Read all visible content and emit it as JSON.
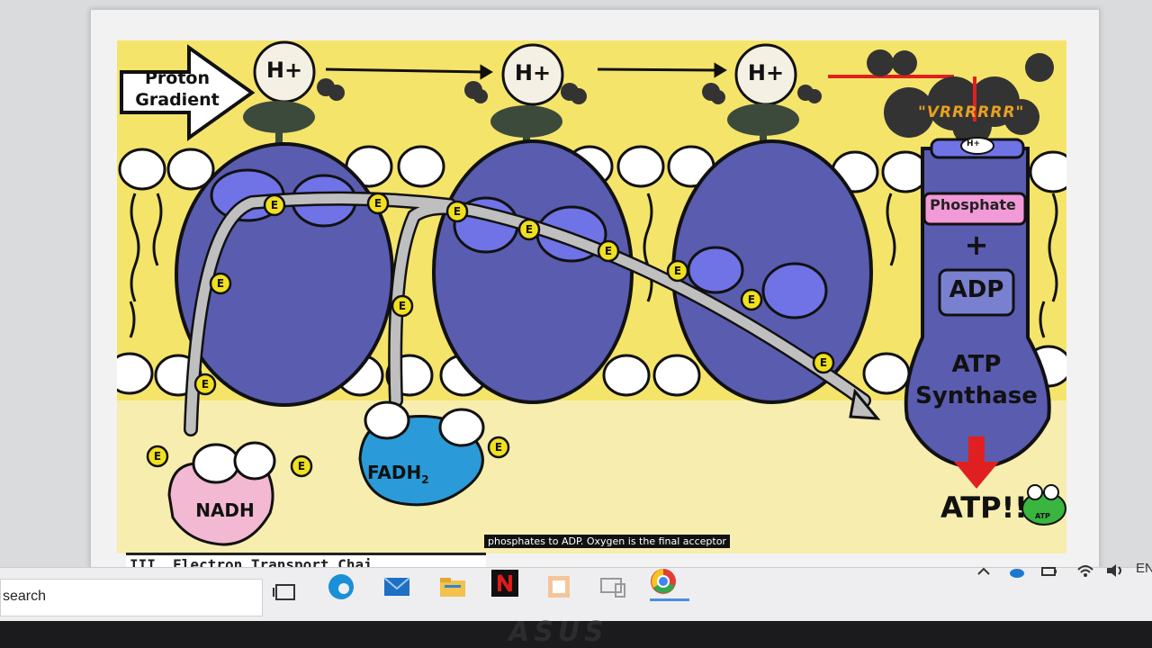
{
  "slide": {
    "proton_gradient_line1": "Proton",
    "proton_gradient_line2": "Gradient",
    "hplus_1": "H+",
    "hplus_2": "H+",
    "hplus_3": "H+",
    "hplus_small": "H+",
    "vrrr": "\"VRRRRRR\"",
    "phosphate": "Phosphate",
    "plus": "+",
    "adp": "ADP",
    "atp_synthase_line1": "ATP",
    "atp_synthase_line2": "Synthase",
    "atp_final": "ATP!!",
    "atp_frog": "ATP",
    "nadh": "NADH",
    "fadh": "FADH",
    "fadh_sub": "2",
    "electron": "E",
    "caption": "phosphates to ADP. Oxygen is the final acceptor",
    "section_title": "III. Electron Transport Chai"
  },
  "taskbar": {
    "search_label": "search",
    "language": "EN"
  },
  "bezel": {
    "brand": "ASUS"
  },
  "colors": {
    "slide_bg": "#f5e46a",
    "protein": "#5a5cb0",
    "protein_spot": "#6f73e6",
    "electron": "#f0e020",
    "nadh": "#f3b8d2",
    "fadh": "#2a9ad8",
    "phosphate": "#f29ad8",
    "arrow_red": "#e02020"
  }
}
